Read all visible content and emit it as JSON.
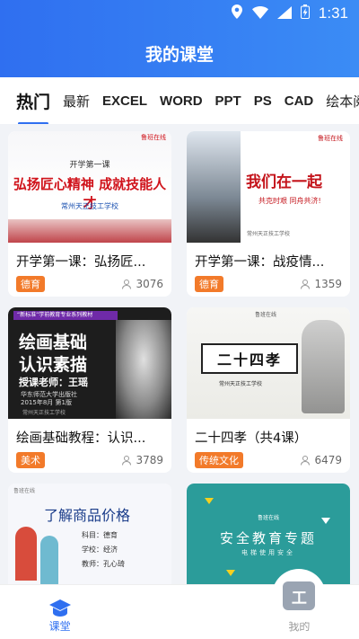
{
  "status_bar": {
    "time": "1:31"
  },
  "header": {
    "title": "我的课堂"
  },
  "tabs": [
    {
      "label": "热门",
      "active": true
    },
    {
      "label": "最新"
    },
    {
      "label": "EXCEL"
    },
    {
      "label": "WORD"
    },
    {
      "label": "PPT"
    },
    {
      "label": "PS"
    },
    {
      "label": "CAD"
    },
    {
      "label": "绘本阅读"
    }
  ],
  "courses": [
    {
      "name": "开学第一课：弘扬匠...",
      "tag": "德育",
      "views": "3076",
      "thumb": {
        "corner": "鲁班在线",
        "small": "开学第一课",
        "title": "弘扬匠心精神 成就技能人才",
        "school": "常州天正技工学校"
      }
    },
    {
      "name": "开学第一课：战疫情...",
      "tag": "德育",
      "views": "1359",
      "thumb": {
        "corner": "鲁班在线",
        "title": "我们在一起",
        "sub": "共克时艰 同舟共济!",
        "foot": "常州天正技工学校"
      }
    },
    {
      "name": "绘画基础教程：认识...",
      "tag": "美术",
      "views": "3789",
      "thumb": {
        "bar": "“新标准”学前教育专业系列教材",
        "title1": "绘画基础",
        "title2": "认识素描",
        "teacher": "授课老师：王瑶",
        "press1": "华东师范大学出版社",
        "press2": "2015年8月 第1版",
        "school": "常州天正技工学校"
      }
    },
    {
      "name": "二十四孝（共4课）",
      "tag": "传统文化",
      "views": "6479",
      "thumb": {
        "corner": "鲁班在线",
        "title": "二十四孝",
        "foot": "常州天正技工学校"
      }
    },
    {
      "name": "",
      "tag": "",
      "views": "",
      "thumb": {
        "corner": "鲁班在线",
        "title": "了解商品价格",
        "subject": "科目：德育",
        "school": "学校：经济",
        "teacher": "教师：孔心琦"
      }
    },
    {
      "name": "",
      "tag": "",
      "views": "",
      "thumb": {
        "corner": "鲁班在线",
        "title": "安全教育专题",
        "sub": "电梯使用安全"
      }
    }
  ],
  "bottom_nav": [
    {
      "label": "课堂",
      "active": true
    },
    {
      "label": "工"
    },
    {
      "label": "我的"
    }
  ],
  "colors": {
    "primary": "#2f6ff0",
    "tag": "#f27a2a",
    "bg": "#f1f3f7"
  }
}
